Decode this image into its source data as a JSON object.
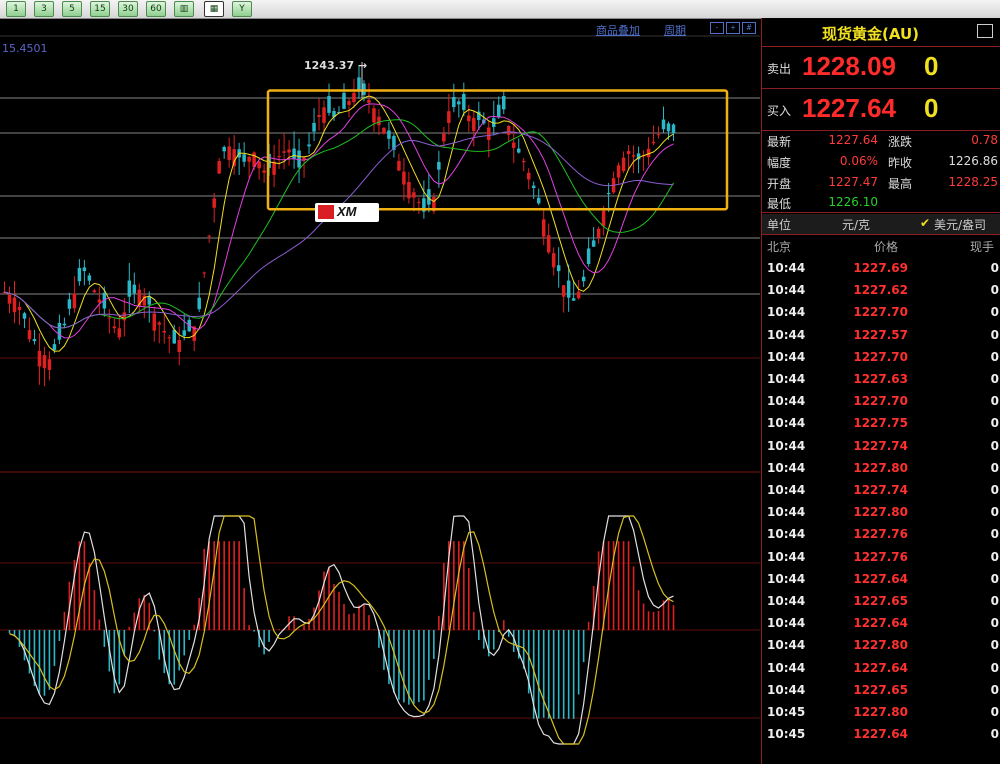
{
  "toolbar": {
    "buttons": [
      "1",
      "3",
      "5",
      "15",
      "30",
      "60",
      "",
      "",
      "Y"
    ],
    "colors": {
      "btn": "#8fcf8f"
    }
  },
  "chart": {
    "links": {
      "overlay": "商品叠加",
      "period": "周期"
    },
    "price_ref": "15.4501",
    "peak_label": "1243.37",
    "logo_text": "XM",
    "colors": {
      "up": "#e02020",
      "down": "#2ab7c8",
      "box": "#f0b010",
      "grid": "#b0b0b0",
      "redline": "#7a1010"
    }
  },
  "chart_data": {
    "type": "candlestick",
    "note_series": [
      "price",
      "macd_histogram"
    ],
    "price_path": [
      1230.2,
      1229.8,
      1228.1,
      1226.5,
      1225.9,
      1227.4,
      1229.8,
      1231.6,
      1230.2,
      1228.9,
      1227.6,
      1229.9,
      1230.4,
      1229.1,
      1227.8,
      1226.9,
      1227.5,
      1228.2,
      1233.5,
      1238.9,
      1239.6,
      1238.4,
      1239.1,
      1237.8,
      1238.7,
      1239.4,
      1238.1,
      1239.7,
      1242.1,
      1241.3,
      1241.9,
      1243.1,
      1242.6,
      1241.4,
      1239.8,
      1238.2,
      1236.7,
      1235.3,
      1236.4,
      1241.6,
      1242.2,
      1241.4,
      1241.1,
      1240.5,
      1241.9,
      1239.5,
      1238.3,
      1236.1,
      1233.8,
      1231.2,
      1229.4,
      1230.7,
      1233.2,
      1235.8,
      1238.1,
      1239.2,
      1238.6,
      1239.5,
      1240.6,
      1240.3
    ],
    "ma_levels": {
      "ma1": "yellow",
      "ma2": "magenta",
      "ma3": "green",
      "ma4": "purple"
    },
    "box": {
      "from_index": 18,
      "to_index": 59,
      "low": 1235.6,
      "high": 1242.9
    }
  },
  "panel": {
    "title": "现货黄金(AU)",
    "sell": {
      "label": "卖出",
      "price": "1228.09",
      "vol": "0"
    },
    "buy": {
      "label": "买入",
      "price": "1227.64",
      "vol": "0"
    },
    "stats": {
      "latest_label": "最新",
      "latest": "1227.64",
      "change_label": "涨跌",
      "change": "0.78",
      "range_label": "幅度",
      "range": "0.06%",
      "prev_label": "昨收",
      "prev": "1226.86",
      "open_label": "开盘",
      "open": "1227.47",
      "high_label": "最高",
      "high": "1228.25",
      "low_label": "最低",
      "low": "1226.10"
    },
    "unit": {
      "label": "单位",
      "value": "元/克",
      "alt": "美元/盎司",
      "check": "✔"
    },
    "tick_head": {
      "time": "北京",
      "price": "价格",
      "vol": "现手"
    },
    "ticks": [
      {
        "t": "10:44",
        "p": "1227.69",
        "v": "0"
      },
      {
        "t": "10:44",
        "p": "1227.62",
        "v": "0"
      },
      {
        "t": "10:44",
        "p": "1227.70",
        "v": "0"
      },
      {
        "t": "10:44",
        "p": "1227.57",
        "v": "0"
      },
      {
        "t": "10:44",
        "p": "1227.70",
        "v": "0"
      },
      {
        "t": "10:44",
        "p": "1227.63",
        "v": "0"
      },
      {
        "t": "10:44",
        "p": "1227.70",
        "v": "0"
      },
      {
        "t": "10:44",
        "p": "1227.75",
        "v": "0"
      },
      {
        "t": "10:44",
        "p": "1227.74",
        "v": "0"
      },
      {
        "t": "10:44",
        "p": "1227.80",
        "v": "0"
      },
      {
        "t": "10:44",
        "p": "1227.74",
        "v": "0"
      },
      {
        "t": "10:44",
        "p": "1227.80",
        "v": "0"
      },
      {
        "t": "10:44",
        "p": "1227.76",
        "v": "0"
      },
      {
        "t": "10:44",
        "p": "1227.76",
        "v": "0"
      },
      {
        "t": "10:44",
        "p": "1227.64",
        "v": "0"
      },
      {
        "t": "10:44",
        "p": "1227.65",
        "v": "0"
      },
      {
        "t": "10:44",
        "p": "1227.64",
        "v": "0"
      },
      {
        "t": "10:44",
        "p": "1227.80",
        "v": "0"
      },
      {
        "t": "10:44",
        "p": "1227.64",
        "v": "0"
      },
      {
        "t": "10:44",
        "p": "1227.65",
        "v": "0"
      },
      {
        "t": "10:45",
        "p": "1227.80",
        "v": "0"
      },
      {
        "t": "10:45",
        "p": "1227.64",
        "v": "0"
      }
    ]
  }
}
